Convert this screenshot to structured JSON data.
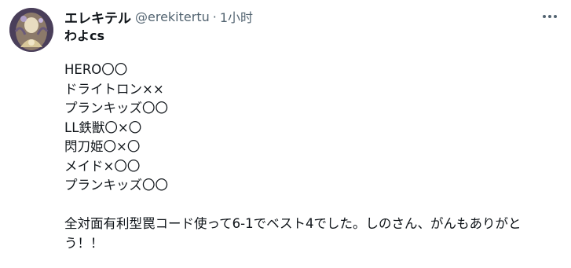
{
  "tweet": {
    "author_name": "エレキテル",
    "handle": "@erekitertu",
    "separator": "·",
    "time": "1小时",
    "more_icon": "more-horizontal-icon",
    "first_line": "わよcs",
    "lines": [
      "HERO〇〇",
      "ドライトロン××",
      "プランキッズ〇〇",
      "LL鉄獣〇×〇",
      "閃刀姫〇×〇",
      "メイド×〇〇",
      "プランキッズ〇〇"
    ],
    "closing": "全対面有利型罠コード使って6-1でベスト4でした。しのさん、がんもありがとう！！"
  }
}
